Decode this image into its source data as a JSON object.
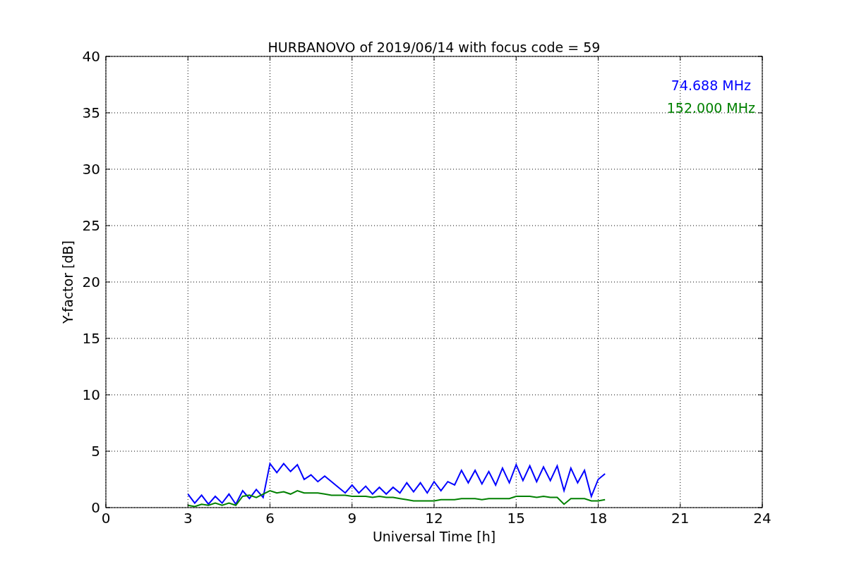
{
  "chart_data": {
    "type": "line",
    "title": "HURBANOVO of 2019/06/14 with focus code = 59",
    "xlabel": "Universal Time [h]",
    "ylabel": "Y-factor [dB]",
    "x": [
      3,
      3.25,
      3.5,
      3.75,
      4,
      4.25,
      4.5,
      4.75,
      5,
      5.25,
      5.5,
      5.75,
      6,
      6.25,
      6.5,
      6.75,
      7,
      7.25,
      7.5,
      7.75,
      8,
      8.25,
      8.5,
      8.75,
      9,
      9.25,
      9.5,
      9.75,
      10,
      10.25,
      10.5,
      10.75,
      11,
      11.25,
      11.5,
      11.75,
      12,
      12.25,
      12.5,
      12.75,
      13,
      13.25,
      13.5,
      13.75,
      14,
      14.25,
      14.5,
      14.75,
      15,
      15.25,
      15.5,
      15.75,
      16,
      16.25,
      16.5,
      16.75,
      17,
      17.25,
      17.5,
      17.75,
      18,
      18.25
    ],
    "series": [
      {
        "name": "74.688 MHz",
        "color": "#0000ff",
        "values": [
          1.2,
          0.4,
          1.1,
          0.3,
          1.0,
          0.4,
          1.2,
          0.3,
          1.5,
          0.8,
          1.6,
          0.9,
          3.9,
          3.1,
          3.9,
          3.2,
          3.8,
          2.5,
          2.9,
          2.3,
          2.8,
          2.3,
          1.8,
          1.3,
          2.0,
          1.3,
          1.9,
          1.2,
          1.8,
          1.2,
          1.8,
          1.3,
          2.2,
          1.4,
          2.2,
          1.3,
          2.3,
          1.5,
          2.3,
          2.0,
          3.3,
          2.2,
          3.3,
          2.1,
          3.2,
          2.0,
          3.5,
          2.2,
          3.8,
          2.4,
          3.7,
          2.3,
          3.6,
          2.4,
          3.7,
          1.5,
          3.5,
          2.2,
          3.3,
          1.0,
          2.5,
          3.0
        ]
      },
      {
        "name": "152.000 MHz",
        "color": "#008000",
        "values": [
          0.2,
          0.1,
          0.3,
          0.2,
          0.4,
          0.2,
          0.4,
          0.2,
          1.0,
          1.1,
          0.9,
          1.2,
          1.5,
          1.3,
          1.4,
          1.2,
          1.5,
          1.3,
          1.3,
          1.3,
          1.2,
          1.1,
          1.1,
          1.1,
          1.0,
          1.0,
          1.0,
          0.9,
          1.0,
          0.9,
          0.9,
          0.8,
          0.7,
          0.6,
          0.6,
          0.6,
          0.6,
          0.7,
          0.7,
          0.7,
          0.8,
          0.8,
          0.8,
          0.7,
          0.8,
          0.8,
          0.8,
          0.8,
          1.0,
          1.0,
          1.0,
          0.9,
          1.0,
          0.9,
          0.9,
          0.3,
          0.8,
          0.8,
          0.8,
          0.6,
          0.6,
          0.7
        ]
      }
    ],
    "xlim": [
      0,
      24
    ],
    "ylim": [
      0,
      40
    ],
    "xticks": [
      0,
      3,
      6,
      9,
      12,
      15,
      18,
      21,
      24
    ],
    "yticks": [
      0,
      5,
      10,
      15,
      20,
      25,
      30,
      35,
      40
    ],
    "grid": true
  }
}
